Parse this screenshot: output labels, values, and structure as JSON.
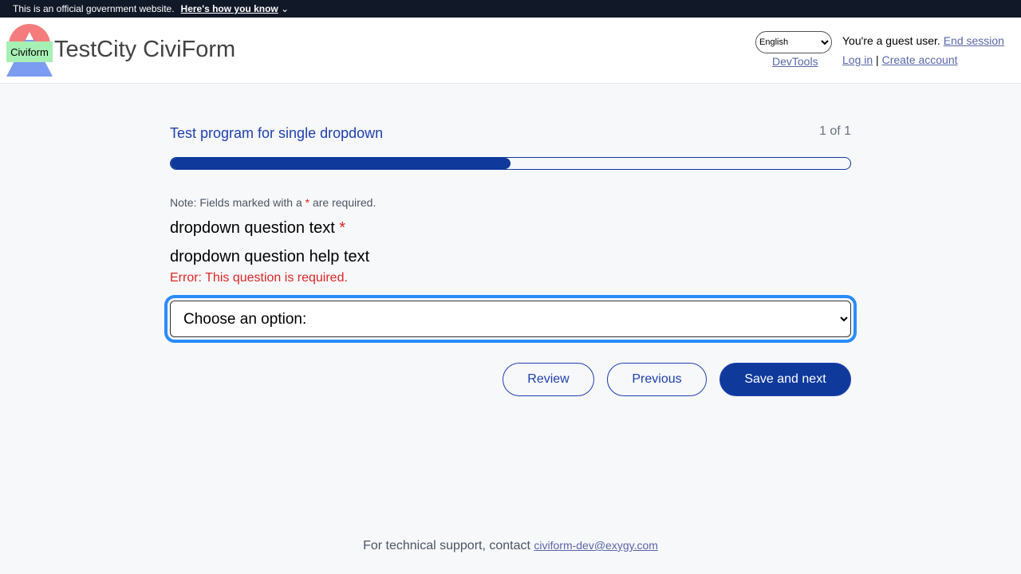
{
  "banner": {
    "text": "This is an official government website.",
    "link": "Here's how you know"
  },
  "header": {
    "logo_text": "Civiform",
    "title": "TestCity CiviForm",
    "language": "English",
    "devtools": "DevTools",
    "guest": "You're a guest user.",
    "end_session": "End session",
    "login": "Log in",
    "sep": "|",
    "create_account": "Create account"
  },
  "main": {
    "program_title": "Test program for single dropdown",
    "block_count": "1 of 1",
    "progress_percent": 50,
    "note_prefix": "Note: Fields marked with a ",
    "note_star": "*",
    "note_suffix": " are required.",
    "question": "dropdown question text",
    "question_star": "*",
    "help": "dropdown question help text",
    "error": "Error: This question is required.",
    "dropdown_selected": "Choose an option:",
    "review": "Review",
    "previous": "Previous",
    "save_next": "Save and next"
  },
  "footer": {
    "text": "For technical support, contact ",
    "email": "civiform-dev@exygy.com"
  },
  "colors": {
    "primary": "#0f3a9c",
    "error": "#dc2626",
    "focus": "#2b8cf9"
  }
}
